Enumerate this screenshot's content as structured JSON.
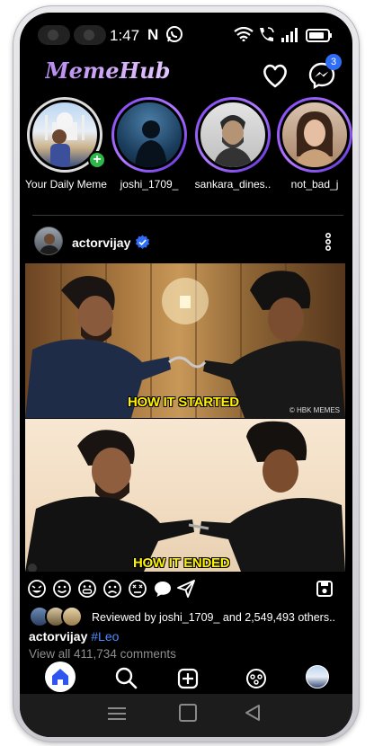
{
  "status_bar": {
    "time": "1:47",
    "carrier_glyph": "N",
    "whatsapp_icon": "whatsapp-icon",
    "wifi_icon": "wifi-icon",
    "call_icon": "wifi-call-icon",
    "signal_icon": "signal-icon",
    "battery_icon": "battery-icon"
  },
  "header": {
    "logo": "MemeHub",
    "messenger_badge": "3"
  },
  "stories": [
    {
      "label": "Your Daily Meme",
      "own": true
    },
    {
      "label": "joshi_1709_"
    },
    {
      "label": "sankara_dines.."
    },
    {
      "label": "not_bad_j"
    }
  ],
  "post": {
    "username": "actorvijay",
    "caption_top": "HOW IT STARTED",
    "caption_bottom": "HOW IT ENDED",
    "image_credit": "© HBK MEMES",
    "liked_by": "Reviewed by joshi_1709_ and 2,549,493 others..",
    "caption_user": "actorvijay",
    "caption_tag": "#Leo",
    "comments": "View all 411,734 comments"
  },
  "colors": {
    "accent": "#7b3ff2",
    "link_blue": "#4b8dff",
    "caption_yellow": "#fff200",
    "verified_blue": "#2f6df6"
  }
}
